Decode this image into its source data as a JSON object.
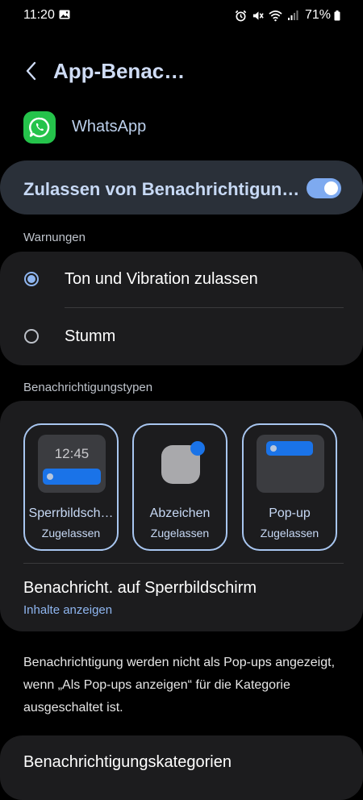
{
  "status_bar": {
    "time": "11:20",
    "battery": "71%"
  },
  "header": {
    "title": "App-Benac…",
    "app_name": "WhatsApp"
  },
  "allow": {
    "label": "Zulassen von Benachrichtigun…",
    "enabled": true
  },
  "warnings": {
    "section_label": "Warnungen",
    "options": [
      {
        "label": "Ton und Vibration zulassen",
        "selected": true
      },
      {
        "label": "Stumm",
        "selected": false
      }
    ]
  },
  "types": {
    "section_label": "Benachrichtigungstypen",
    "lock_time": "12:45",
    "tiles": [
      {
        "label": "Sperrbildsch…",
        "status": "Zugelassen"
      },
      {
        "label": "Abzeichen",
        "status": "Zugelassen"
      },
      {
        "label": "Pop-up",
        "status": "Zugelassen"
      }
    ],
    "lockscreen_title": "Benachricht. auf Sperrbildschirm",
    "lockscreen_value": "Inhalte anzeigen"
  },
  "info": "Benachrichtigung werden nicht als Pop-ups angezeigt, wenn „Als Pop-ups anzeigen“ für die Kategorie ausgeschaltet ist.",
  "categories": {
    "label": "Benachrichtigungskategorien"
  },
  "colors": {
    "accent": "#8fb6f0",
    "toggle": "#7eaaf0",
    "whatsapp": "#25c34b",
    "badge": "#1a73e8"
  }
}
